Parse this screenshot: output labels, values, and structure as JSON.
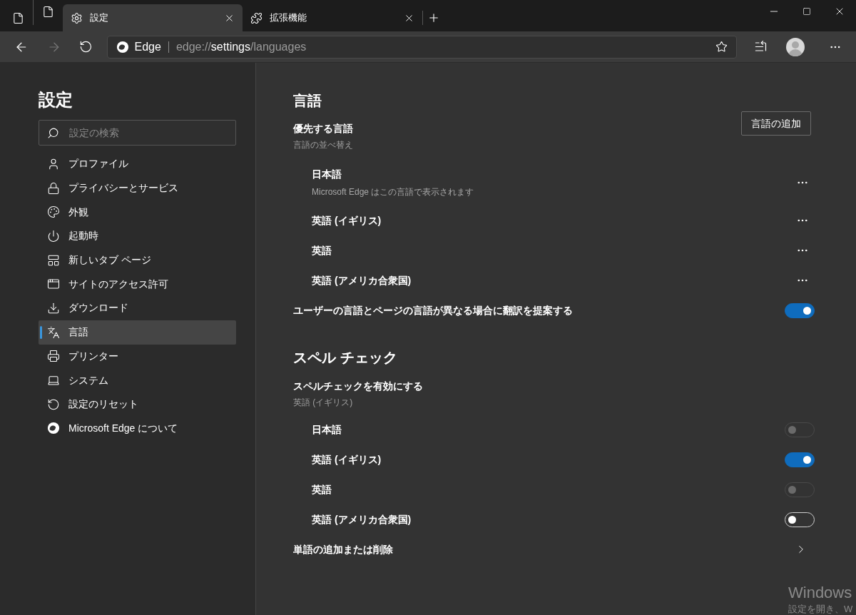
{
  "tabs": [
    {
      "kind": "pinned",
      "selected": false
    },
    {
      "kind": "pinned",
      "selected": false
    },
    {
      "kind": "settings",
      "label": "設定",
      "selected": true
    },
    {
      "kind": "extensions",
      "label": "拡張機能",
      "selected": false
    }
  ],
  "address_bar": {
    "brand": "Edge",
    "url_scheme": "edge://",
    "url_host": "settings",
    "url_path": "/languages"
  },
  "sidebar": {
    "title": "設定",
    "search": {
      "placeholder": "設定の検索"
    },
    "items": [
      {
        "label": "プロファイル",
        "selected": false
      },
      {
        "label": "プライバシーとサービス",
        "selected": false
      },
      {
        "label": "外観",
        "selected": false
      },
      {
        "label": "起動時",
        "selected": false
      },
      {
        "label": "新しいタブ ページ",
        "selected": false
      },
      {
        "label": "サイトのアクセス許可",
        "selected": false
      },
      {
        "label": "ダウンロード",
        "selected": false
      },
      {
        "label": "言語",
        "selected": true
      },
      {
        "label": "プリンター",
        "selected": false
      },
      {
        "label": "システム",
        "selected": false
      },
      {
        "label": "設定のリセット",
        "selected": false
      },
      {
        "label": "Microsoft Edge について",
        "selected": false
      }
    ]
  },
  "languages": {
    "title": "言語",
    "preferred": {
      "label": "優先する言語",
      "sublabel": "言語の並べ替え",
      "button": "言語の追加",
      "items": [
        {
          "name": "日本語",
          "note": "Microsoft Edge はこの言語で表示されます"
        },
        {
          "name": "英語 (イギリス)"
        },
        {
          "name": "英語"
        },
        {
          "name": "英語 (アメリカ合衆国)"
        }
      ]
    },
    "translate": {
      "label": "ユーザーの言語とページの言語が異なる場合に翻訳を提案する",
      "on": true,
      "disabled": false
    }
  },
  "spellcheck": {
    "title": "スペル チェック",
    "label": "スペルチェックを有効にする",
    "sublabel": "英語 (イギリス)",
    "items": [
      {
        "name": "日本語",
        "on": false,
        "disabled": true
      },
      {
        "name": "英語 (イギリス)",
        "on": true,
        "disabled": false
      },
      {
        "name": "英語",
        "on": false,
        "disabled": true
      },
      {
        "name": "英語 (アメリカ合衆国)",
        "on": false,
        "disabled": false
      }
    ],
    "custom_words": "単語の追加または削除"
  },
  "activation_notice": {
    "title": "Windows",
    "text": "設定を開き、W"
  }
}
